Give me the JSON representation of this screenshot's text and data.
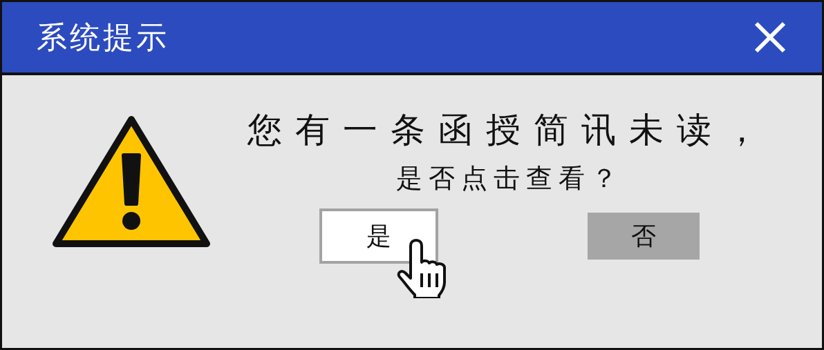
{
  "window": {
    "title": "系统提示"
  },
  "message": {
    "line_1": "您有一条函授简讯未读，",
    "line_2": "是否点击查看？"
  },
  "buttons": [
    {
      "label": "是",
      "selected": true
    },
    {
      "label": "否",
      "selected": false
    }
  ]
}
